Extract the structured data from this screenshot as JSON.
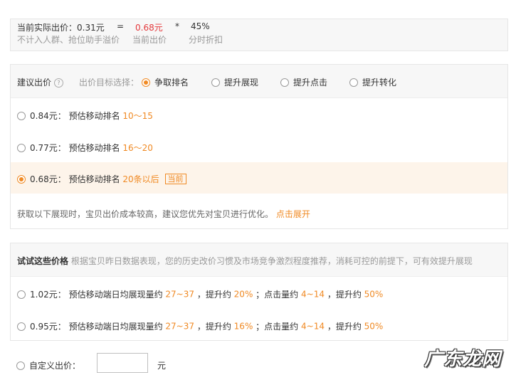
{
  "actual_price": {
    "label": "当前实际出价：0.31元",
    "equals": "=",
    "current_value": "0.68元",
    "times": "*",
    "discount_value": "45%",
    "note_excluded": "不计入人群、抢位助手溢价",
    "note_current": "当前出价",
    "note_discount": "分时折扣"
  },
  "suggested": {
    "title": "建议出价",
    "help_icon": "?",
    "goal_label": "出价目标选择：",
    "goals": [
      {
        "label": "争取排名",
        "selected": true
      },
      {
        "label": "提升展现",
        "selected": false
      },
      {
        "label": "提升点击",
        "selected": false
      },
      {
        "label": "提升转化",
        "selected": false
      }
    ],
    "options": [
      {
        "price": "0.84元：",
        "desc": "预估移动排名",
        "value": "10～15",
        "selected": false
      },
      {
        "price": "0.77元：",
        "desc": "预估移动排名",
        "value": "16～20",
        "selected": false
      },
      {
        "price": "0.68元：",
        "desc": "预估移动排名",
        "value": "20条以后",
        "badge": "当前",
        "selected": true
      }
    ],
    "tip": "获取以下展现时，宝贝出价成本较高，建议您优先对宝贝进行优化。",
    "expand_link": "点击展开"
  },
  "try_prices": {
    "title": "试试这些价格",
    "desc": "根据宝贝昨日数据表现，您的历史改价习惯及市场竞争激烈程度推荐，消耗可控的前提下，可有效提升展现",
    "options": [
      {
        "price": "1.02元：",
        "label1": "预估移动端日均展现量约",
        "value1": "27~37",
        "label2": "，提升约",
        "value2": "20%",
        "label3": "；点击量约",
        "value3": "4~14",
        "label4": "，提升约",
        "value4": "50%"
      },
      {
        "price": "0.95元：",
        "label1": "预估移动端日均展现量约",
        "value1": "27~37",
        "label2": "，提升约",
        "value2": "16%",
        "label3": "；点击量约",
        "value3": "4~14",
        "label4": "，提升约",
        "value4": "50%"
      }
    ]
  },
  "custom": {
    "label": "自定义出价：",
    "input_value": "",
    "unit": "元"
  },
  "watermark": "广东龙网",
  "colors": {
    "accent": "#f08a24",
    "price_red": "#e4393c",
    "active_row": "#fdf4ea"
  }
}
